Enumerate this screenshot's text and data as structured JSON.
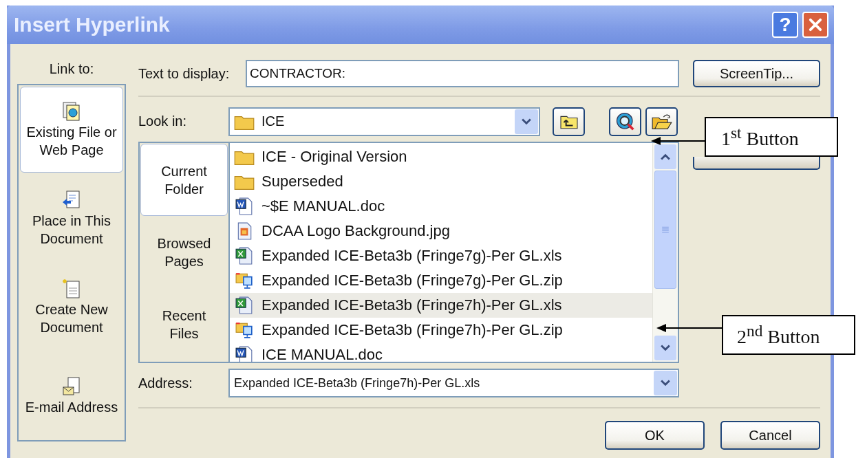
{
  "window": {
    "title": "Insert Hyperlink",
    "help_button": "?"
  },
  "link_to": {
    "label": "Link to:",
    "items": [
      {
        "label": "Existing File or\nWeb Page",
        "kind": "file",
        "selected": true
      },
      {
        "label": "Place in This\nDocument",
        "kind": "place",
        "selected": false
      },
      {
        "label": "Create New\nDocument",
        "kind": "new",
        "selected": false
      },
      {
        "label": "E-mail Address",
        "kind": "email",
        "selected": false
      }
    ]
  },
  "text_to_display": {
    "label": "Text to display:",
    "value": "CONTRACTOR:"
  },
  "screentip_button": "ScreenTip...",
  "look_in": {
    "label": "Look in:",
    "value": "ICE"
  },
  "nav": [
    {
      "label": "Current\nFolder",
      "selected": true
    },
    {
      "label": "Browsed\nPages",
      "selected": false
    },
    {
      "label": "Recent\nFiles",
      "selected": false
    }
  ],
  "files": [
    {
      "name": "ICE - Original Version",
      "kind": "folder",
      "selected": false
    },
    {
      "name": "Superseded",
      "kind": "folder",
      "selected": false
    },
    {
      "name": "~$E MANUAL.doc",
      "kind": "word",
      "selected": false
    },
    {
      "name": "DCAA Logo Background.jpg",
      "kind": "image",
      "selected": false
    },
    {
      "name": "Expanded ICE-Beta3b (Fringe7g)-Per GL.xls",
      "kind": "excel",
      "selected": false
    },
    {
      "name": "Expanded ICE-Beta3b (Fringe7g)-Per GL.zip",
      "kind": "zip",
      "selected": false
    },
    {
      "name": "Expanded ICE-Beta3b (Fringe7h)-Per GL.xls",
      "kind": "excel",
      "selected": true
    },
    {
      "name": "Expanded ICE-Beta3b (Fringe7h)-Per GL.zip",
      "kind": "zip",
      "selected": false
    },
    {
      "name": "ICE MANUAL.doc",
      "kind": "word",
      "selected": false
    }
  ],
  "address": {
    "label": "Address:",
    "value": "Expanded ICE-Beta3b (Fringe7h)-Per GL.xls"
  },
  "buttons": [
    {
      "label": "OK"
    },
    {
      "label": "Cancel"
    }
  ],
  "callouts": [
    {
      "text": "1$^{st}$ Button"
    },
    {
      "text": "2$^{nd}$ Button"
    }
  ]
}
